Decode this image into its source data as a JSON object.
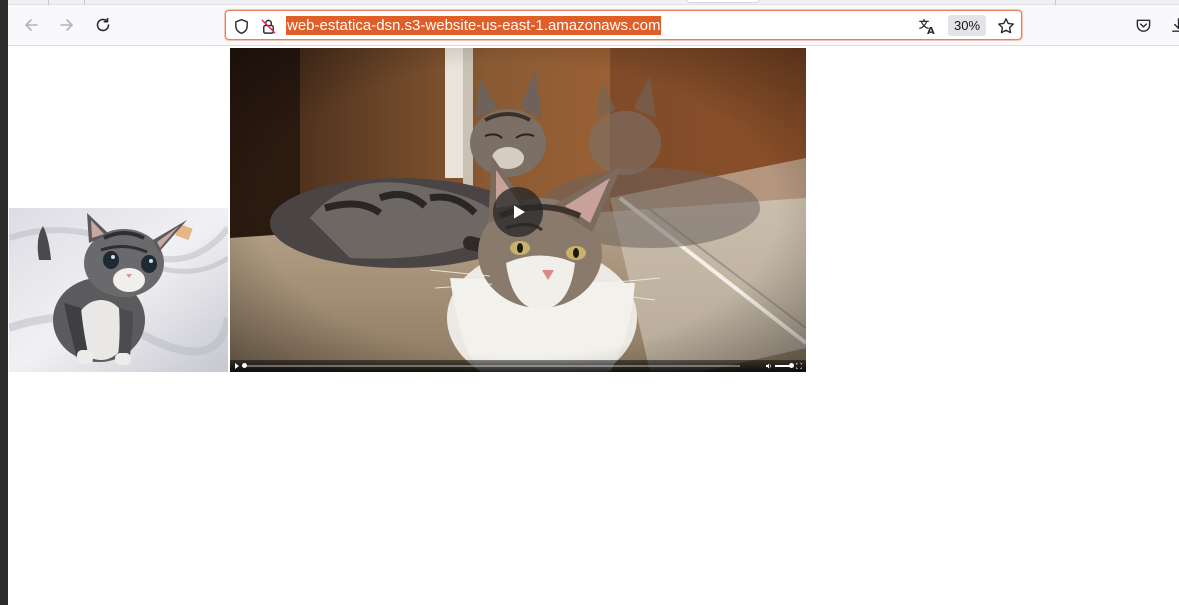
{
  "browser": {
    "url": "web-estatica-dsn.s3-website-us-east-1.amazonaws.com",
    "zoom_label": "30%",
    "icons": {
      "back": "back-arrow-icon",
      "forward": "forward-arrow-icon",
      "reload": "reload-icon",
      "tracking": "shield-icon",
      "insecure": "insecure-lock-icon",
      "translate": "translate-icon",
      "bookmark": "star-icon",
      "pocket": "pocket-icon",
      "downloads": "download-icon"
    }
  },
  "page": {
    "image": {
      "kind": "photo",
      "subject": "kitten"
    },
    "video": {
      "poster_subject": "cats",
      "progress": 0.0,
      "volume": 1.0
    }
  },
  "colors": {
    "url_selection": "#e05e28",
    "urlbar_border": "#e0835f"
  }
}
